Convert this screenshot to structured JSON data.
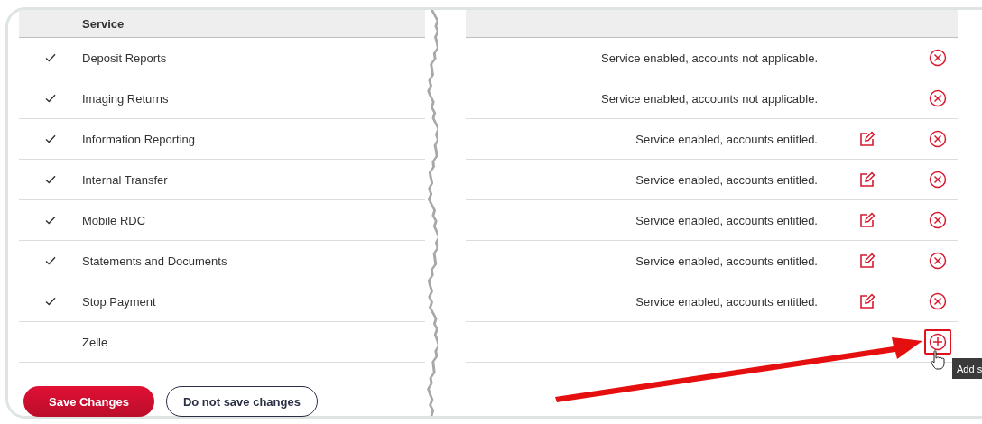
{
  "table": {
    "columns": [
      {
        "label": "Service"
      }
    ],
    "rows": [
      {
        "enabled": true,
        "name": "Deposit Reports",
        "status": "Service enabled, accounts not applicable.",
        "editable": false,
        "kind": "remove"
      },
      {
        "enabled": true,
        "name": "Imaging Returns",
        "status": "Service enabled, accounts not applicable.",
        "editable": false,
        "kind": "remove"
      },
      {
        "enabled": true,
        "name": "Information Reporting",
        "status": "Service enabled, accounts entitled.",
        "editable": true,
        "kind": "remove"
      },
      {
        "enabled": true,
        "name": "Internal Transfer",
        "status": "Service enabled, accounts entitled.",
        "editable": true,
        "kind": "remove"
      },
      {
        "enabled": true,
        "name": "Mobile RDC",
        "status": "Service enabled, accounts entitled.",
        "editable": true,
        "kind": "remove"
      },
      {
        "enabled": true,
        "name": "Statements and Documents",
        "status": "Service enabled, accounts entitled.",
        "editable": true,
        "kind": "remove"
      },
      {
        "enabled": true,
        "name": "Stop Payment",
        "status": "Service enabled, accounts entitled.",
        "editable": true,
        "kind": "remove"
      },
      {
        "enabled": false,
        "name": "Zelle",
        "editable": false,
        "kind": "add"
      }
    ]
  },
  "tooltip": {
    "text": "Add s"
  },
  "buttons": [
    {
      "kind": "primary",
      "label": "Save Changes"
    },
    {
      "kind": "secondary",
      "label": "Do not save changes"
    }
  ]
}
